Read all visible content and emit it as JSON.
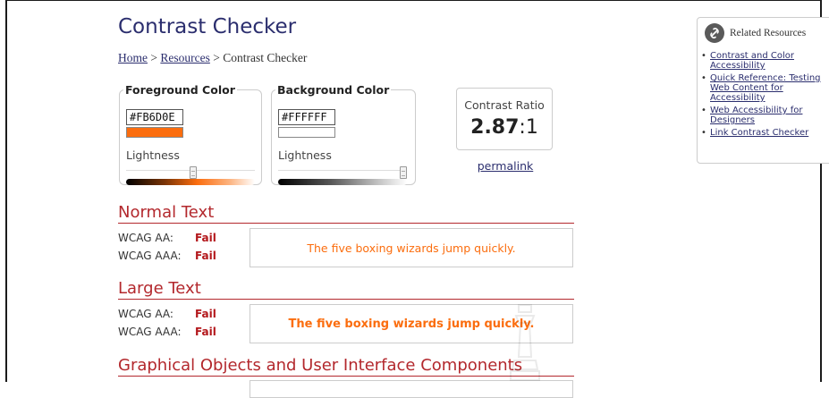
{
  "page": {
    "title": "Contrast Checker"
  },
  "breadcrumb": {
    "home": "Home",
    "separator": ">",
    "resources": "Resources",
    "current": "Contrast Checker"
  },
  "foreground": {
    "legend": "Foreground Color",
    "hex_value": "#FB6D0E",
    "swatch_color": "#FB6D0E",
    "lightness_label": "Lightness",
    "lightness_fraction": 0.52
  },
  "background": {
    "legend": "Background Color",
    "hex_value": "#FFFFFF",
    "swatch_color": "#FFFFFF",
    "lightness_label": "Lightness",
    "lightness_fraction": 1.0
  },
  "contrast": {
    "label": "Contrast Ratio",
    "ratio_bold": "2.87",
    "ratio_suffix": ":1",
    "permalink": "permalink"
  },
  "sections": {
    "normal": {
      "heading": "Normal Text",
      "aa_label": "WCAG AA:",
      "aa_result": "Fail",
      "aaa_label": "WCAG AAA:",
      "aaa_result": "Fail",
      "sample": "The five boxing wizards jump quickly."
    },
    "large": {
      "heading": "Large Text",
      "aa_label": "WCAG AA:",
      "aa_result": "Fail",
      "aaa_label": "WCAG AAA:",
      "aaa_result": "Fail",
      "sample": "The five boxing wizards jump quickly."
    },
    "graphical": {
      "heading": "Graphical Objects and User Interface Components"
    }
  },
  "sidebar": {
    "title": "Related Resources",
    "icon": "info-icon",
    "links": [
      "Contrast and Color Accessibility",
      "Quick Reference: Testing Web Content for Accessibility",
      "Web Accessibility for Designers",
      "Link Contrast Checker"
    ]
  },
  "colors": {
    "title": "#2B2E6E",
    "heading_red": "#B3282D",
    "fail_red": "#B3171B",
    "sample_orange": "#FB6D0E"
  }
}
